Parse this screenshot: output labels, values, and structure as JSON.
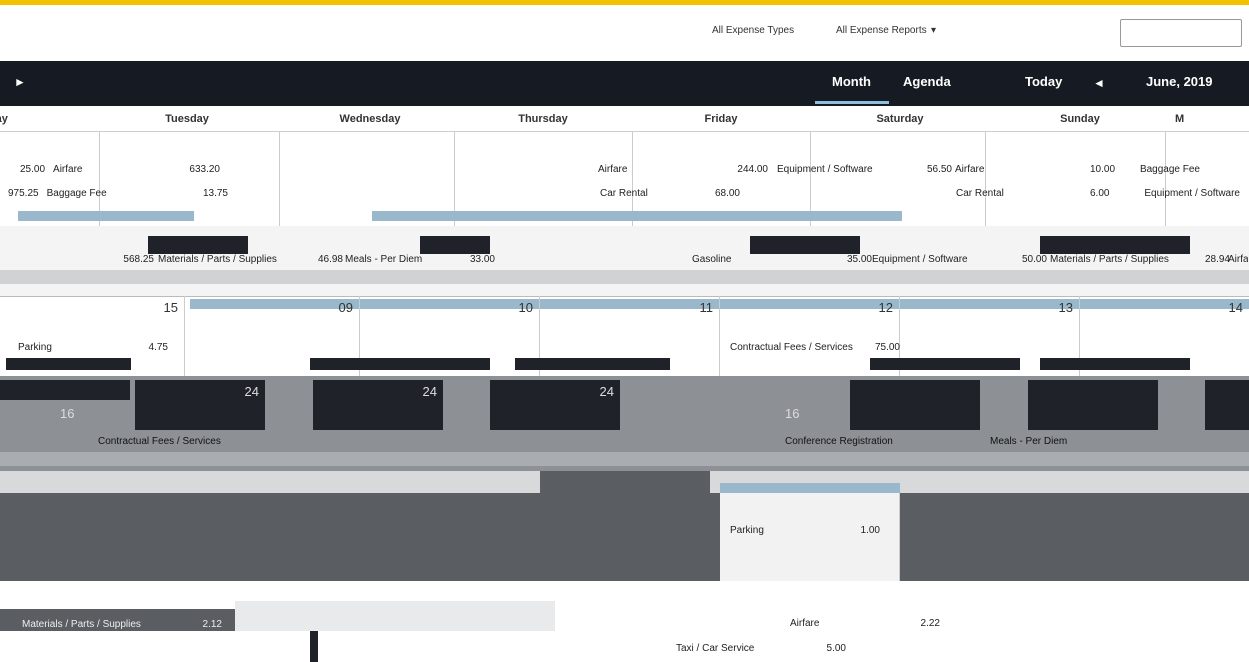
{
  "header": {
    "filters": [
      "All Expense Types",
      "All Expense Reports"
    ],
    "search_placeholder": ""
  },
  "toolbar": {
    "view_month": "Month",
    "view_agenda": "Agenda",
    "today": "Today",
    "current_month": "June, 2019"
  },
  "weekdays": [
    "nday",
    "Tuesday",
    "Wednesday",
    "Thursday",
    "Friday",
    "Saturday",
    "Sunday",
    "M"
  ],
  "weeks": [
    {
      "days": [
        "",
        "",
        "",
        "",
        "",
        "",
        "",
        ""
      ],
      "events": [
        {
          "label": "Airfare",
          "amount": "25.00"
        },
        {
          "label": "Airfare",
          "amount": "633.20"
        },
        {
          "label": "Airfare",
          "amount": "244.00"
        },
        {
          "label": "Equipment / Software",
          "amount": "56.50"
        },
        {
          "label": "Airfare",
          "amount": "10.00"
        },
        {
          "label": "Baggage Fee",
          "amount": ""
        },
        {
          "label": "Baggage Fee",
          "amount": "975.25"
        },
        {
          "label": "",
          "amount": "13.75"
        },
        {
          "label": "Car Rental",
          "amount": "68.00"
        },
        {
          "label": "Car Rental",
          "amount": "6.00"
        },
        {
          "label": "Equipment / Software",
          "amount": ""
        }
      ]
    },
    {
      "days": [
        "",
        "",
        "",
        "",
        "",
        "",
        "",
        ""
      ],
      "events": [
        {
          "label": "",
          "amount": "568.25"
        },
        {
          "label": "Materials / Parts / Supplies",
          "amount": "46.98"
        },
        {
          "label": "Meals - Per Diem",
          "amount": "33.00"
        },
        {
          "label": "Gasoline",
          "amount": "35.00"
        },
        {
          "label": "Equipment / Software",
          "amount": "50.00"
        },
        {
          "label": "Materials / Parts / Supplies",
          "amount": "28.94"
        },
        {
          "label": "Airfa",
          "amount": ""
        }
      ]
    },
    {
      "days": [
        "15",
        "09",
        "10",
        "11",
        "12",
        "13",
        "14"
      ],
      "events": [
        {
          "label": "Parking",
          "amount": "4.75"
        },
        {
          "label": "Contractual Fees / Services",
          "amount": "75.00"
        }
      ]
    },
    {
      "days": [
        "16",
        "24",
        "24",
        "24",
        "16",
        "",
        ""
      ],
      "events": [
        {
          "label": "Contractual Fees / Services",
          "amount": ""
        },
        {
          "label": "Conference Registration",
          "amount": ""
        },
        {
          "label": "Meals - Per Diem",
          "amount": ""
        }
      ]
    },
    {
      "days": [
        "",
        "",
        "",
        "",
        "",
        "",
        ""
      ],
      "events": [
        {
          "label": "Parking",
          "amount": "1.00"
        }
      ]
    },
    {
      "days": [
        "",
        "",
        "",
        "",
        "",
        "",
        ""
      ],
      "events": [
        {
          "label": "Materials / Parts / Supplies",
          "amount": "2.12"
        },
        {
          "label": "Airfare",
          "amount": "2.22"
        },
        {
          "label": "Taxi / Car Service",
          "amount": "5.00"
        }
      ]
    }
  ]
}
